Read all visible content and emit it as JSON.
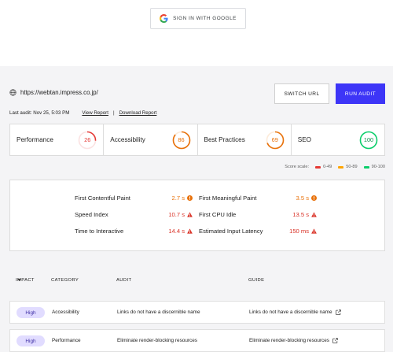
{
  "signin": {
    "label": "SIGN IN WITH GOOGLE",
    "icon": "google-g-icon"
  },
  "url": {
    "text": "https://webtan.impress.co.jp/",
    "icon": "globe-icon"
  },
  "buttons": {
    "switch_url": "SWITCH URL",
    "run_audit": "RUN AUDIT",
    "run_audit_color": "#3d35f7"
  },
  "audit_info": {
    "last_audit": "Last audit: Nov 25, 5:03 PM",
    "view_report": "View Report",
    "separator": "|",
    "download_report": "Download Report"
  },
  "scores": [
    {
      "label": "Performance",
      "value": "26",
      "score": 26,
      "color": "#e53935"
    },
    {
      "label": "Accessibility",
      "value": "86",
      "score": 86,
      "color": "#e8710a"
    },
    {
      "label": "Best Practices",
      "value": "69",
      "score": 69,
      "color": "#e8710a"
    },
    {
      "label": "SEO",
      "value": "100",
      "score": 100,
      "color": "#0cce6b"
    }
  ],
  "legend": {
    "title": "Score scale:",
    "items": [
      {
        "label": "0-49",
        "color": "#e53935"
      },
      {
        "label": "50-89",
        "color": "#ffa400"
      },
      {
        "label": "90-100",
        "color": "#0cce6b"
      }
    ]
  },
  "metrics": [
    {
      "label": "First Contentful Paint",
      "value": "2.7 s",
      "status": "orange"
    },
    {
      "label": "First Meaningful Paint",
      "value": "3.5 s",
      "status": "orange"
    },
    {
      "label": "Speed Index",
      "value": "10.7 s",
      "status": "red"
    },
    {
      "label": "First CPU Idle",
      "value": "13.5 s",
      "status": "red"
    },
    {
      "label": "Time to Interactive",
      "value": "14.4 s",
      "status": "red"
    },
    {
      "label": "Estimated Input Latency",
      "value": "150 ms",
      "status": "red"
    }
  ],
  "table": {
    "headers": {
      "impact": "IMPACT",
      "category": "CATEGORY",
      "audit": "AUDIT",
      "guide": "GUIDE"
    },
    "rows": [
      {
        "impact": "High",
        "category": "Accessibility",
        "audit": "Links do not have a discernible name",
        "guide": "Links do not have a discernible name"
      },
      {
        "impact": "High",
        "category": "Performance",
        "audit": "Eliminate render-blocking resources",
        "guide": "Eliminate render-blocking resources"
      }
    ]
  }
}
